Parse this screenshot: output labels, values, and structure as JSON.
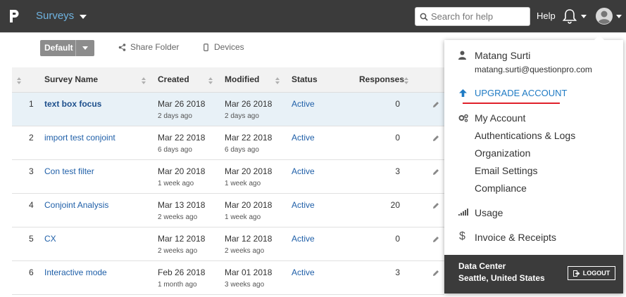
{
  "header": {
    "product": "Surveys",
    "search_placeholder": "Search for help",
    "help": "Help"
  },
  "toolbar": {
    "default_label": "Default",
    "share_folder": "Share Folder",
    "devices": "Devices"
  },
  "table": {
    "columns": [
      "Survey Name",
      "Created",
      "Modified",
      "Status",
      "Responses"
    ],
    "rows": [
      {
        "num": "1",
        "name": "text box focus",
        "created": "Mar 26 2018",
        "created_ago": "2 days ago",
        "modified": "Mar 26 2018",
        "modified_ago": "2 days ago",
        "status": "Active",
        "responses": "0"
      },
      {
        "num": "2",
        "name": "import test conjoint",
        "created": "Mar 22 2018",
        "created_ago": "6 days ago",
        "modified": "Mar 22 2018",
        "modified_ago": "6 days ago",
        "status": "Active",
        "responses": "0"
      },
      {
        "num": "3",
        "name": "Con test filter",
        "created": "Mar 20 2018",
        "created_ago": "1 week ago",
        "modified": "Mar 20 2018",
        "modified_ago": "1 week ago",
        "status": "Active",
        "responses": "3"
      },
      {
        "num": "4",
        "name": "Conjoint Analysis",
        "created": "Mar 13 2018",
        "created_ago": "2 weeks ago",
        "modified": "Mar 20 2018",
        "modified_ago": "1 week ago",
        "status": "Active",
        "responses": "20"
      },
      {
        "num": "5",
        "name": "CX",
        "created": "Mar 12 2018",
        "created_ago": "2 weeks ago",
        "modified": "Mar 12 2018",
        "modified_ago": "2 weeks ago",
        "status": "Active",
        "responses": "0"
      },
      {
        "num": "6",
        "name": "Interactive mode",
        "created": "Feb 26 2018",
        "created_ago": "1 month ago",
        "modified": "Mar 01 2018",
        "modified_ago": "3 weeks ago",
        "status": "Active",
        "responses": "3"
      }
    ]
  },
  "account_menu": {
    "user_name": "Matang Surti",
    "user_email": "matang.surti@questionpro.com",
    "upgrade": "UPGRADE ACCOUNT",
    "items": [
      "My Account",
      "Authentications & Logs",
      "Organization",
      "Email Settings",
      "Compliance"
    ],
    "usage": "Usage",
    "invoice": "Invoice & Receipts",
    "data_center_label": "Data Center",
    "data_center_location": "Seattle, United States",
    "logout": "LOGOUT"
  },
  "colors": {
    "topbar": "#3b3b3b",
    "link": "#1f5fa8",
    "accent_underline": "#e0202a",
    "selected_row": "#e8f1f7"
  }
}
